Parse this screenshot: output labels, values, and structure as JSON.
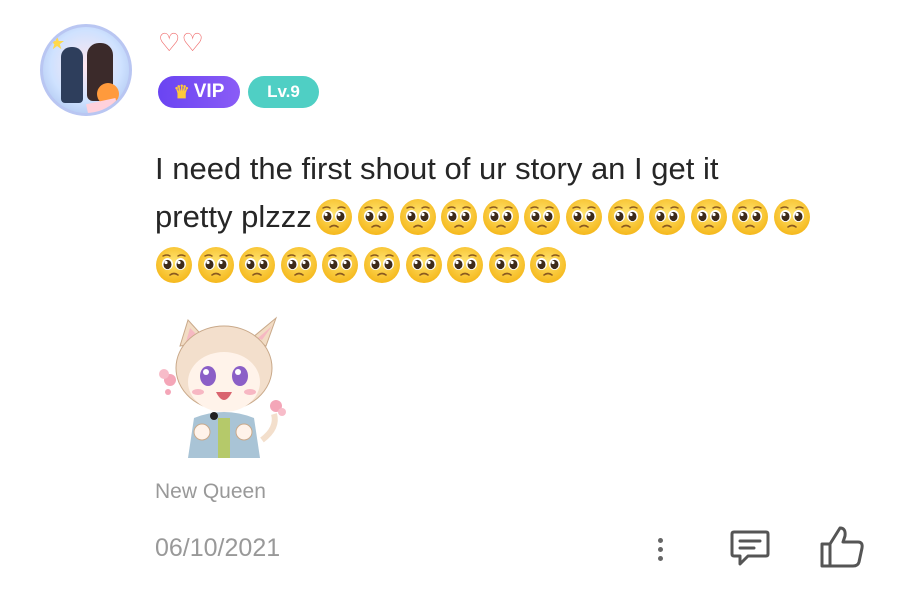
{
  "post": {
    "author_hearts": "♡♡",
    "vip_label": "VIP",
    "level_label": "Lv.9",
    "message_text": "I need the first shout of ur story an I get it pretty plzzz",
    "message_line1": "I need the first shout of ur story an I get it",
    "message_line2_prefix": "pretty plzzz",
    "emoji_name": "pleading-face",
    "emoji_count_row1": 12,
    "emoji_count_row2": 10,
    "signature": "New Queen",
    "date": "06/10/2021"
  },
  "actions": {
    "more_icon": "more-vertical-icon",
    "comment_icon": "comment-icon",
    "like_icon": "thumbs-up-icon"
  },
  "colors": {
    "vip_gradient_start": "#6a44f2",
    "vip_gradient_end": "#8a5cf6",
    "level_badge": "#4fcfc4",
    "hearts": "#ef6a6a",
    "meta_text": "#999999"
  }
}
